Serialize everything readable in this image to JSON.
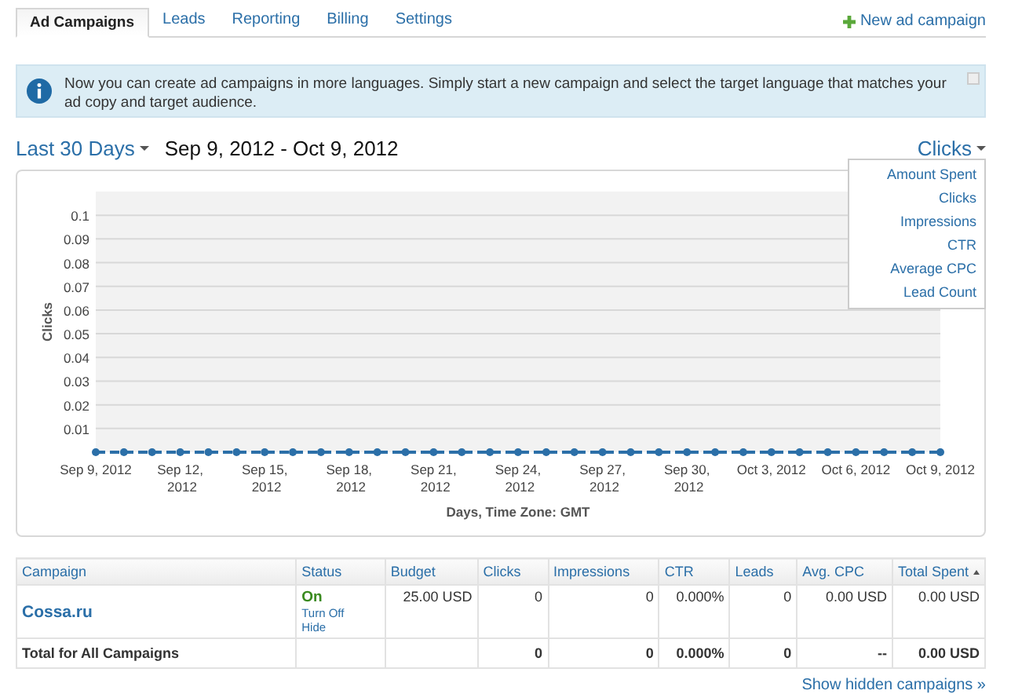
{
  "tabs": [
    {
      "label": "Ad Campaigns",
      "selected": true
    },
    {
      "label": "Leads",
      "selected": false
    },
    {
      "label": "Reporting",
      "selected": false
    },
    {
      "label": "Billing",
      "selected": false
    },
    {
      "label": "Settings",
      "selected": false
    }
  ],
  "new_campaign": "New ad campaign",
  "notice": {
    "text": "Now you can create ad campaigns in more languages. Simply start a new campaign and select the target language that matches your ad copy and target audience."
  },
  "date_range": {
    "preset": "Last 30 Days",
    "range": "Sep 9, 2012 - Oct 9, 2012"
  },
  "metric_selector": {
    "label": "Clicks",
    "menu": [
      "Amount Spent",
      "Clicks",
      "Impressions",
      "CTR",
      "Average CPC",
      "Lead Count"
    ]
  },
  "chart_data": {
    "type": "line",
    "xlabel": "Days, Time Zone: GMT",
    "ylabel": "Clicks",
    "ylim": [
      0,
      0.11
    ],
    "yticks": [
      0.01,
      0.02,
      0.03,
      0.04,
      0.05,
      0.06,
      0.07,
      0.08,
      0.09,
      0.1
    ],
    "categories": [
      "Sep 9, 2012",
      null,
      null,
      "Sep 12, 2012",
      null,
      null,
      "Sep 15, 2012",
      null,
      null,
      "Sep 18, 2012",
      null,
      null,
      "Sep 21, 2012",
      null,
      null,
      "Sep 24, 2012",
      null,
      null,
      "Sep 27, 2012",
      null,
      null,
      "Sep 30, 2012",
      null,
      null,
      "Oct 3, 2012",
      null,
      null,
      "Oct 6, 2012",
      null,
      null,
      "Oct 9, 2012"
    ],
    "grid": true,
    "series": [
      {
        "color": "#2b6fa8",
        "line_style": "dashed",
        "marker": "circle",
        "values": [
          0,
          0,
          0,
          0,
          0,
          0,
          0,
          0,
          0,
          0,
          0,
          0,
          0,
          0,
          0,
          0,
          0,
          0,
          0,
          0,
          0,
          0,
          0,
          0,
          0,
          0,
          0,
          0,
          0,
          0,
          0
        ]
      }
    ]
  },
  "table": {
    "columns": [
      {
        "label": "Campaign",
        "sorted": false
      },
      {
        "label": "Status",
        "sorted": false
      },
      {
        "label": "Budget",
        "sorted": false
      },
      {
        "label": "Clicks",
        "sorted": false
      },
      {
        "label": "Impressions",
        "sorted": false
      },
      {
        "label": "CTR",
        "sorted": false
      },
      {
        "label": "Leads",
        "sorted": false
      },
      {
        "label": "Avg. CPC",
        "sorted": false
      },
      {
        "label": "Total Spent",
        "sorted": true
      }
    ],
    "rows": [
      {
        "campaign": "Cossa.ru",
        "status": "On",
        "actions": [
          "Turn Off",
          "Hide"
        ],
        "budget": "25.00 USD",
        "clicks": "0",
        "impressions": "0",
        "ctr": "0.000%",
        "leads": "0",
        "avg_cpc": "0.00 USD",
        "total_spent": "0.00 USD"
      }
    ],
    "total": {
      "campaign": "Total for All Campaigns",
      "clicks": "0",
      "impressions": "0",
      "ctr": "0.000%",
      "leads": "0",
      "avg_cpc": "--",
      "total_spent": "0.00 USD"
    }
  },
  "show_hidden": "Show hidden campaigns »"
}
